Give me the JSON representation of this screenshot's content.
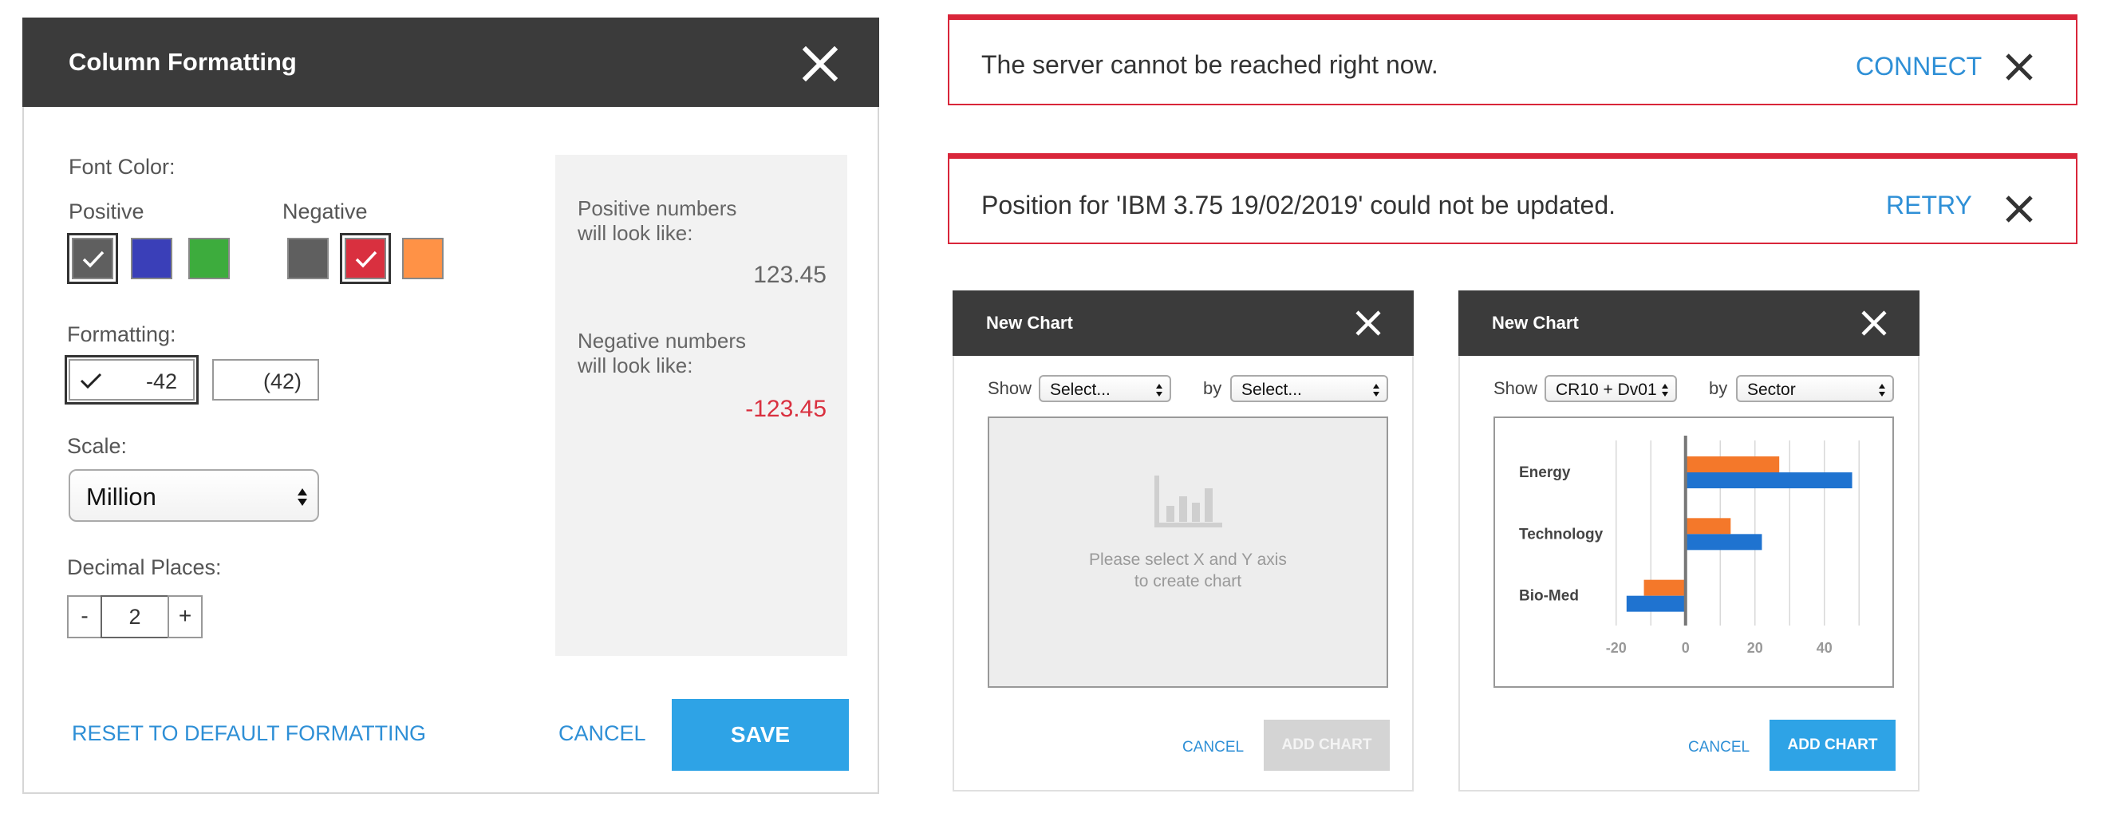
{
  "column_formatting": {
    "title": "Column Formatting",
    "font_color_label": "Font Color:",
    "positive_label": "Positive",
    "negative_label": "Negative",
    "positive_colors": [
      "#5f5f5f",
      "#3a3fb8",
      "#3dac3d"
    ],
    "negative_colors": [
      "#5f5f5f",
      "#d9303f",
      "#ff9246"
    ],
    "formatting_label": "Formatting:",
    "format_options": [
      "-42",
      "(42)"
    ],
    "scale_label": "Scale:",
    "scale_value": "Million",
    "decimal_label": "Decimal Places:",
    "decimal_minus": "-",
    "decimal_value": "2",
    "decimal_plus": "+",
    "preview": {
      "positive_text": "Positive numbers will look like:",
      "positive_value": "123.45",
      "negative_text": "Negative numbers will look like:",
      "negative_value": "-123.45",
      "negative_color": "#d9303f"
    },
    "reset_label": "RESET TO DEFAULT FORMATTING",
    "cancel_label": "CANCEL",
    "save_label": "SAVE"
  },
  "notifications": [
    {
      "message": "The server cannot be reached right now.",
      "action": "CONNECT"
    },
    {
      "message": "Position for 'IBM 3.75 19/02/2019' could not be updated.",
      "action": "RETRY"
    }
  ],
  "new_chart_empty": {
    "title": "New Chart",
    "show_label": "Show",
    "show_value": "Select...",
    "by_label": "by",
    "by_value": "Select...",
    "placeholder_line1": "Please select X and Y axis",
    "placeholder_line2": "to create chart",
    "cancel_label": "CANCEL",
    "add_label": "ADD CHART"
  },
  "new_chart_filled": {
    "title": "New Chart",
    "show_label": "Show",
    "show_value": "CR10 + Dv01",
    "by_label": "by",
    "by_value": "Sector",
    "cancel_label": "CANCEL",
    "add_label": "ADD CHART"
  },
  "chart_data": {
    "type": "bar",
    "orientation": "horizontal",
    "categories": [
      "Energy",
      "Technology",
      "Bio-Med"
    ],
    "series": [
      {
        "color": "#f4782a",
        "values": [
          27,
          13,
          -12
        ]
      },
      {
        "color": "#1f73d0",
        "values": [
          48,
          22,
          -17
        ]
      }
    ],
    "xticks": [
      "-20",
      "0",
      "20",
      "40"
    ],
    "xlim": [
      -25,
      55
    ],
    "grid": true,
    "legend": "none"
  },
  "colors": {
    "accent": "#2ea3e6",
    "error": "#d9263a",
    "header": "#3b3b3b"
  }
}
